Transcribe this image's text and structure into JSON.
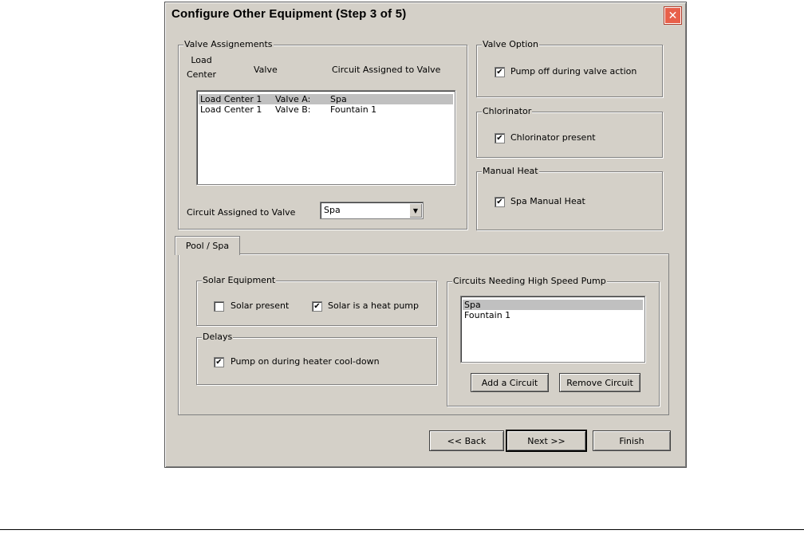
{
  "dialog": {
    "title": "Configure Other Equipment (Step 3 of 5)",
    "close_glyph": "✕"
  },
  "valve_assignments": {
    "group_title": "Valve Assignements",
    "col_load_center": "Load\nCenter",
    "col_valve": "Valve",
    "col_circuit": "Circuit Assigned to Valve",
    "rows": [
      {
        "load_center": "Load Center 1",
        "valve": "Valve A:",
        "circuit": "Spa",
        "selected": true
      },
      {
        "load_center": "Load Center 1",
        "valve": "Valve B:",
        "circuit": "Fountain 1",
        "selected": false
      }
    ],
    "circuit_label": "Circuit Assigned to Valve",
    "circuit_value": "Spa"
  },
  "valve_option": {
    "group_title": "Valve Option",
    "checkbox_label": "Pump off during valve action",
    "checked": true
  },
  "chlorinator": {
    "group_title": "Chlorinator",
    "checkbox_label": "Chlorinator present",
    "checked": true
  },
  "manual_heat": {
    "group_title": "Manual Heat",
    "checkbox_label": "Spa Manual Heat",
    "checked": true
  },
  "tabs": [
    {
      "label": "Pool / Spa",
      "active": true
    }
  ],
  "solar": {
    "group_title": "Solar Equipment",
    "present_label": "Solar present",
    "present_checked": false,
    "heat_pump_label": "Solar is a heat pump",
    "heat_pump_checked": true
  },
  "delays": {
    "group_title": "Delays",
    "checkbox_label": "Pump on during heater cool-down",
    "checked": true
  },
  "high_speed": {
    "group_title": "Circuits Needing High Speed Pump",
    "items": [
      {
        "label": "Spa",
        "selected": true
      },
      {
        "label": "Fountain 1",
        "selected": false
      }
    ],
    "add_label": "Add a Circuit",
    "remove_label": "Remove Circuit"
  },
  "footer": {
    "back_label": "<< Back",
    "next_label": "Next >>",
    "finish_label": "Finish"
  },
  "check_glyph": "✔"
}
